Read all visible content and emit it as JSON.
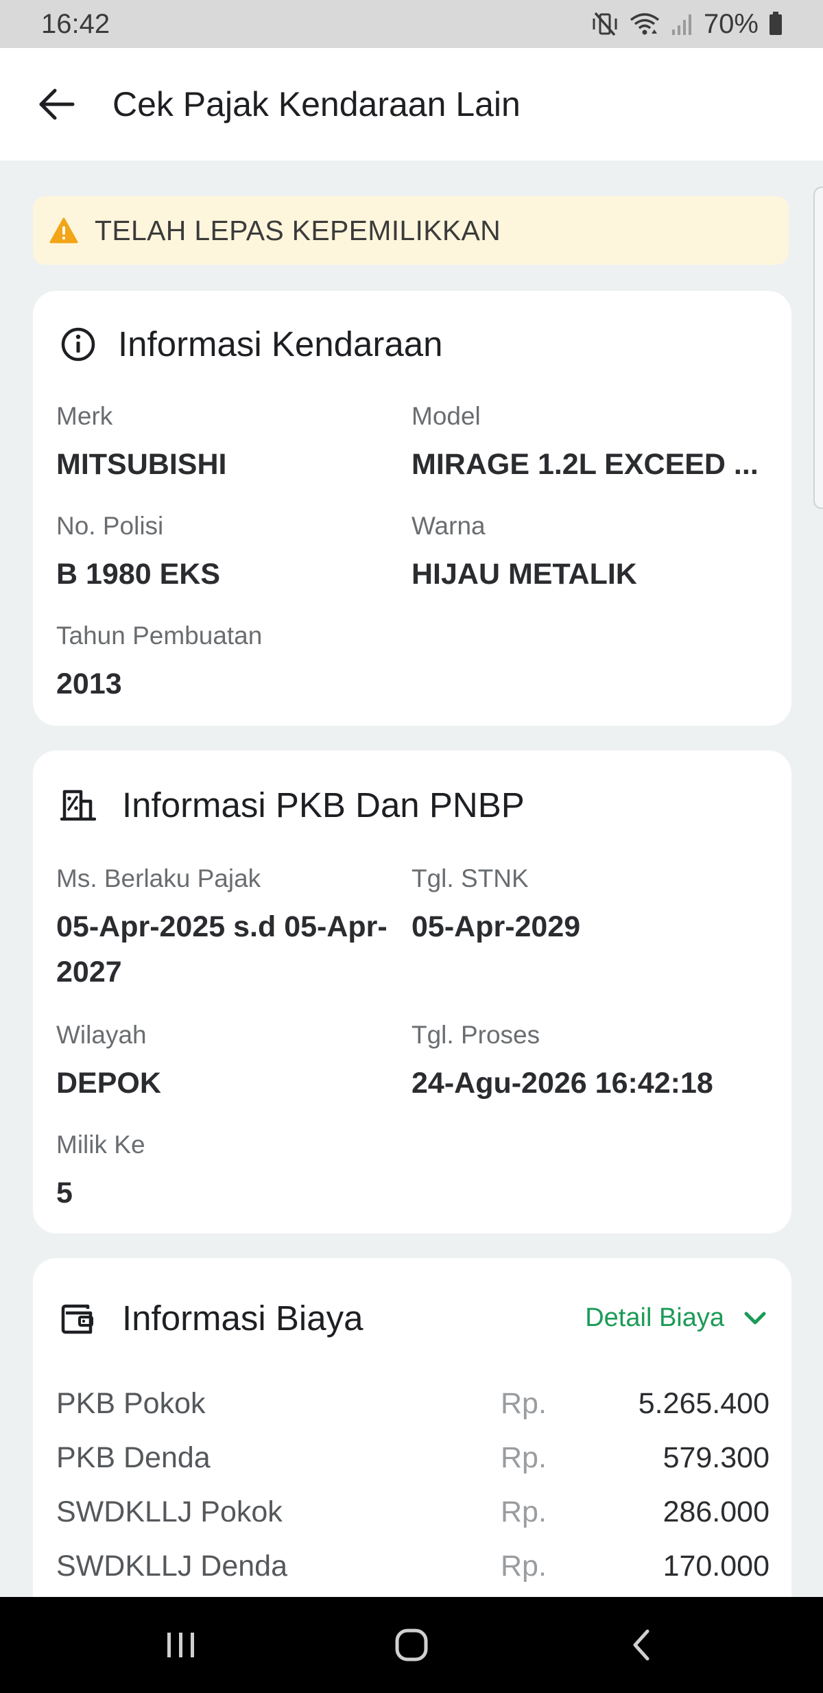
{
  "status_bar": {
    "time": "16:42",
    "battery": "70%"
  },
  "app_bar": {
    "title": "Cek Pajak Kendaraan Lain"
  },
  "warning": {
    "text": "TELAH LEPAS KEPEMILIKKAN"
  },
  "vehicle_info": {
    "title": "Informasi Kendaraan",
    "fields": [
      {
        "label": "Merk",
        "value": "MITSUBISHI"
      },
      {
        "label": "Model",
        "value": "MIRAGE 1.2L EXCEED ..."
      },
      {
        "label": "No. Polisi",
        "value": "B 1980 EKS"
      },
      {
        "label": "Warna",
        "value": "HIJAU METALIK"
      },
      {
        "label": "Tahun Pembuatan",
        "value": "2013"
      }
    ]
  },
  "pkb_info": {
    "title": "Informasi PKB Dan PNBP",
    "fields": [
      {
        "label": "Ms. Berlaku Pajak",
        "value": "05-Apr-2025 s.d 05-Apr-2027"
      },
      {
        "label": "Tgl. STNK",
        "value": "05-Apr-2029"
      },
      {
        "label": "Wilayah",
        "value": "DEPOK"
      },
      {
        "label": "Tgl. Proses",
        "value": "24-Agu-2026 16:42:18"
      },
      {
        "label": "Milik Ke",
        "value": "5"
      }
    ]
  },
  "cost_info": {
    "title": "Informasi Biaya",
    "detail_label": "Detail Biaya",
    "rows": [
      {
        "name": "PKB Pokok",
        "currency": "Rp.",
        "amount": "5.265.400"
      },
      {
        "name": "PKB Denda",
        "currency": "Rp.",
        "amount": "579.300"
      },
      {
        "name": "SWDKLLJ Pokok",
        "currency": "Rp.",
        "amount": "286.000"
      },
      {
        "name": "SWDKLLJ Denda",
        "currency": "Rp.",
        "amount": "170.000"
      }
    ]
  },
  "colors": {
    "accent_green": "#1c9b57",
    "warning_bg": "#fdf6dc",
    "warning_icon": "#f2a516"
  },
  "icons": {
    "back": "arrow-left-icon",
    "warning": "warning-triangle-icon",
    "info": "info-circle-icon",
    "tax": "tax-building-icon",
    "wallet": "wallet-icon",
    "chevron": "chevron-down-icon",
    "nav_recents": "recents-icon",
    "nav_home": "home-icon",
    "nav_back": "nav-back-icon"
  }
}
